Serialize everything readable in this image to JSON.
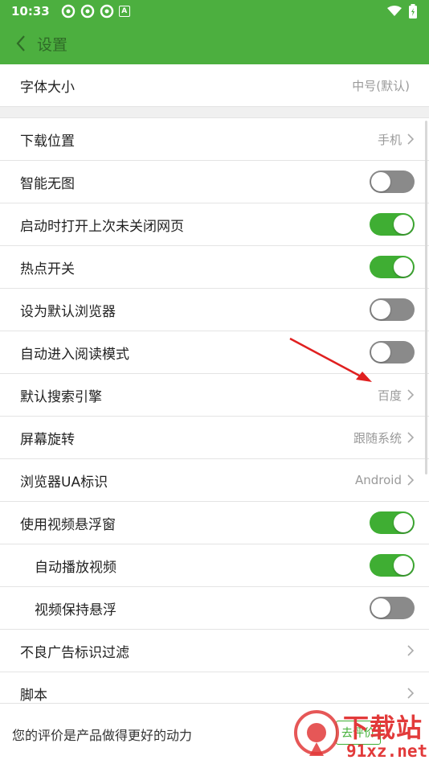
{
  "status": {
    "time": "10:33",
    "notif_letter": "A"
  },
  "header": {
    "title": "设置"
  },
  "settings": {
    "font_size": {
      "label": "字体大小",
      "value": "中号(默认)"
    },
    "download_location": {
      "label": "下载位置",
      "value": "手机"
    },
    "smart_no_image": {
      "label": "智能无图",
      "on": false
    },
    "restore_tabs": {
      "label": "启动时打开上次未关闭网页",
      "on": true
    },
    "hotspot": {
      "label": "热点开关",
      "on": true
    },
    "default_browser": {
      "label": "设为默认浏览器",
      "on": false
    },
    "auto_reading": {
      "label": "自动进入阅读模式",
      "on": false
    },
    "search_engine": {
      "label": "默认搜索引擎",
      "value": "百度"
    },
    "rotation": {
      "label": "屏幕旋转",
      "value": "跟随系统"
    },
    "ua": {
      "label": "浏览器UA标识",
      "value": "Android"
    },
    "floating_video": {
      "label": "使用视频悬浮窗",
      "on": true
    },
    "autoplay_video": {
      "label": "自动播放视频",
      "on": true
    },
    "keep_floating": {
      "label": "视频保持悬浮",
      "on": false
    },
    "ad_filter": {
      "label": "不良广告标识过滤"
    },
    "script": {
      "label": "脚本"
    }
  },
  "bottom": {
    "prompt": "您的评价是产品做得更好的动力",
    "rate_label": "去评价"
  },
  "watermark": {
    "line1": "下载站",
    "line2": "91xz.net"
  },
  "colors": {
    "brand_green": "#4caf3f",
    "toggle_on": "#3fae33",
    "toggle_off": "#8a8a8a",
    "arrow_red": "#e02020"
  }
}
